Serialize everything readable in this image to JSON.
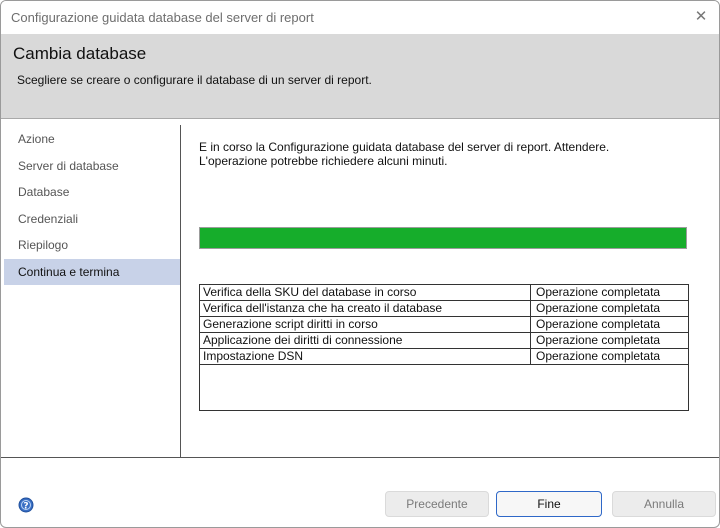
{
  "window": {
    "title": "Configurazione guidata database del server di report"
  },
  "header": {
    "title": "Cambia database",
    "subtitle": "Scegliere se creare o configurare il database di un server di report."
  },
  "sidebar": {
    "items": [
      {
        "label": "Azione"
      },
      {
        "label": "Server di database"
      },
      {
        "label": "Database"
      },
      {
        "label": "Credenziali"
      },
      {
        "label": "Riepilogo"
      },
      {
        "label": "Continua e termina"
      }
    ],
    "active_index": 5
  },
  "main": {
    "message_line1": "E in corso la Configurazione guidata database del server di report. Attendere.",
    "message_line2": "L'operazione potrebbe richiedere alcuni minuti.",
    "progress_percent": 100,
    "progress_color": "#16ad2b",
    "steps": [
      {
        "step": "Verifica della SKU del database in corso",
        "status": "Operazione completata"
      },
      {
        "step": "Verifica dell'istanza che ha creato il database",
        "status": "Operazione completata"
      },
      {
        "step": "Generazione script diritti in corso",
        "status": "Operazione completata"
      },
      {
        "step": "Applicazione dei diritti di connessione",
        "status": "Operazione completata"
      },
      {
        "step": "Impostazione DSN",
        "status": "Operazione completata"
      }
    ]
  },
  "footer": {
    "help_icon": "help-icon",
    "prev_label": "Precedente",
    "finish_label": "Fine",
    "cancel_label": "Annulla"
  }
}
